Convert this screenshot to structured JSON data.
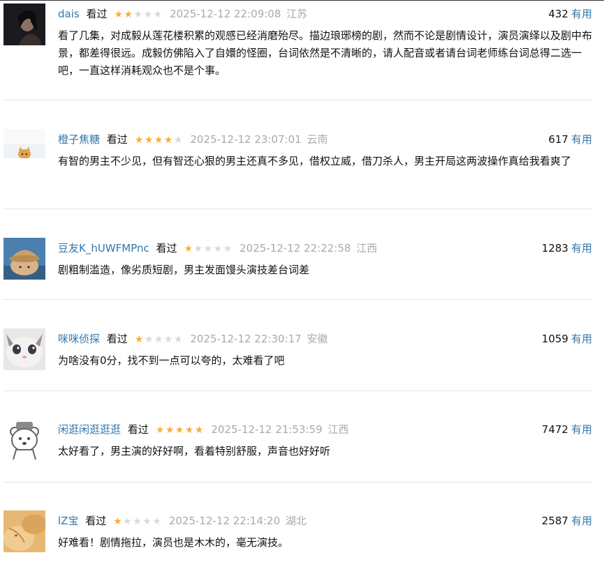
{
  "colors": {
    "link": "#3377aa",
    "star_on": "#ffac2d",
    "star_off": "#d9d9d9",
    "meta": "#aaaaaa"
  },
  "comments": [
    {
      "user": "dais",
      "status": "看过",
      "rating": 2,
      "time": "2025-12-12 22:09:08",
      "location": "江苏",
      "votes": "432",
      "useful_label": "有用",
      "content": "看了几集，对成毅从莲花楼积累的观感已经消磨殆尽。描边琅琊榜的剧，然而不论是剧情设计，演员演绎以及剧中布景，都差得很远。成毅仿佛陷入了自嬛的怪圈，台词依然是不清晰的，请人配音或者请台词老师练台词总得二选一吧，一直这样消耗观众也不是个事。",
      "avatar_icon": "avatar-woman-dark-photo"
    },
    {
      "user": "橙子焦糖",
      "status": "看过",
      "rating": 4,
      "time": "2025-12-12 23:07:01",
      "location": "云南",
      "votes": "617",
      "useful_label": "有用",
      "content": "有智的男主不少见，但有智还心狠的男主还真不多见，借权立威，借刀杀人，男主开局这两波操作真给我看爽了",
      "avatar_icon": "avatar-cat-peeking"
    },
    {
      "user": "豆友K_hUWFMPnc",
      "status": "看过",
      "rating": 1,
      "time": "2025-12-12 22:22:58",
      "location": "江西",
      "votes": "1283",
      "useful_label": "有用",
      "content": "剧粗制滥造，像劣质短剧，男主发面馒头演技差台词差",
      "avatar_icon": "avatar-dog-with-hat"
    },
    {
      "user": "咪咪侦探",
      "status": "看过",
      "rating": 1,
      "time": "2025-12-12 22:30:17",
      "location": "安徽",
      "votes": "1059",
      "useful_label": "有用",
      "content": "为啥没有0分，找不到一点可以夸的，太难看了吧",
      "avatar_icon": "avatar-sad-kitten"
    },
    {
      "user": "闲逛闲逛逛逛",
      "status": "看过",
      "rating": 5,
      "time": "2025-12-12 21:53:59",
      "location": "江西",
      "votes": "7472",
      "useful_label": "有用",
      "content": "太好看了，男主演的好好啊，看着特别舒服，声音也好好听",
      "avatar_icon": "avatar-bear-cartoon"
    },
    {
      "user": "lZ宝",
      "status": "看过",
      "rating": 1,
      "time": "2025-12-12 22:14:20",
      "location": "湖北",
      "votes": "2587",
      "useful_label": "有用",
      "content": "好难看！剧情拖拉，演员也是木木的，毫无演技。",
      "avatar_icon": "avatar-golden-cat"
    }
  ]
}
